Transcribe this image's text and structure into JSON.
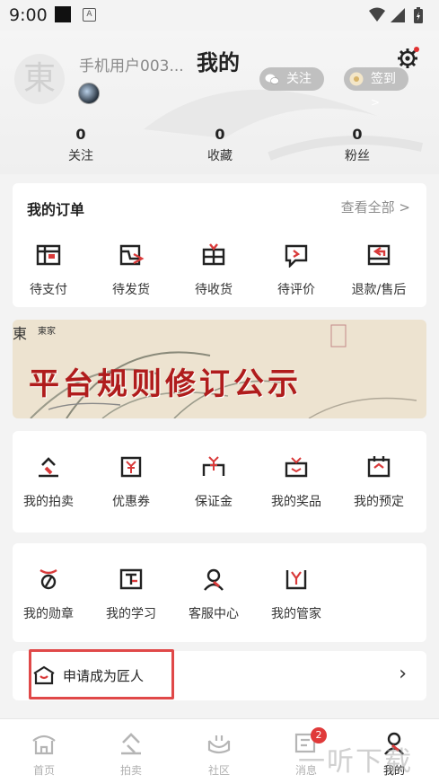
{
  "status_bar": {
    "time": "9:00",
    "app_letter": "A"
  },
  "header": {
    "title": "我的",
    "username": "手机用户003...",
    "avatar_char": "東",
    "follow_label": "关注",
    "checkin_label": "签到",
    "checkin_chevron": ">"
  },
  "stats": [
    {
      "value": "0",
      "label": "关注"
    },
    {
      "value": "0",
      "label": "收藏"
    },
    {
      "value": "0",
      "label": "粉丝"
    }
  ],
  "orders": {
    "title": "我的订单",
    "view_all": "查看全部",
    "chevron": ">",
    "items": [
      {
        "label": "待支付",
        "icon": "pending-payment-icon"
      },
      {
        "label": "待发货",
        "icon": "pending-shipment-icon"
      },
      {
        "label": "待收货",
        "icon": "pending-receipt-icon"
      },
      {
        "label": "待评价",
        "icon": "pending-review-icon"
      },
      {
        "label": "退款/售后",
        "icon": "refund-icon"
      }
    ]
  },
  "banner": {
    "logo": "東",
    "brand": "東家",
    "headline": "平台规则修订公示",
    "pages": 3,
    "active_page": 1
  },
  "services": {
    "row1": [
      {
        "label": "我的拍卖",
        "icon": "auction-icon"
      },
      {
        "label": "优惠券",
        "icon": "coupon-icon"
      },
      {
        "label": "保证金",
        "icon": "deposit-icon"
      },
      {
        "label": "我的奖品",
        "icon": "prize-icon"
      },
      {
        "label": "我的预定",
        "icon": "reservation-icon"
      }
    ],
    "row2": [
      {
        "label": "我的勋章",
        "icon": "medal-icon"
      },
      {
        "label": "我的学习",
        "icon": "study-icon"
      },
      {
        "label": "客服中心",
        "icon": "customer-service-icon"
      },
      {
        "label": "我的管家",
        "icon": "butler-icon"
      }
    ]
  },
  "apply": {
    "label": "申请成为匠人",
    "chevron": "›"
  },
  "tabbar": [
    {
      "label": "首页",
      "icon": "home-icon",
      "active": false
    },
    {
      "label": "拍卖",
      "icon": "auction-tab-icon",
      "active": false
    },
    {
      "label": "社区",
      "icon": "community-icon",
      "active": false
    },
    {
      "label": "消息",
      "icon": "message-icon",
      "active": false,
      "badge": "2"
    },
    {
      "label": "我的",
      "icon": "profile-icon",
      "active": true
    }
  ],
  "watermark": "一听下载",
  "colors": {
    "accent": "#d93a3a",
    "banner_text": "#b01c1c",
    "background": "#f3f3f3"
  }
}
